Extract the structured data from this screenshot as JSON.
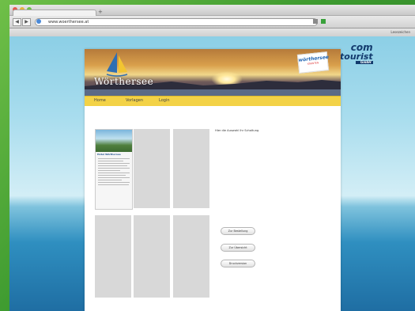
{
  "browser": {
    "url": "www.woerthersee.at",
    "bookmarks_label": "Lesezeichen"
  },
  "site": {
    "brand": "Wörthersee",
    "badge_line1": "wörthersee",
    "badge_line2": "KÄRNTEN",
    "menu": [
      "Home",
      "Vorlagen",
      "Login"
    ],
    "intro_text": "Hier die Auswahl Ihr Schaltung",
    "brochure_title": "Hotel Wörthersee",
    "buttons": [
      "Zur Bestellung",
      "Zur Übersicht",
      "Druckversion"
    ]
  },
  "logo": {
    "line1": "com",
    "line2": "tourist",
    "line3": "GmbH"
  },
  "colors": {
    "menubar": "#f3d247",
    "background": "#4aa33a"
  }
}
